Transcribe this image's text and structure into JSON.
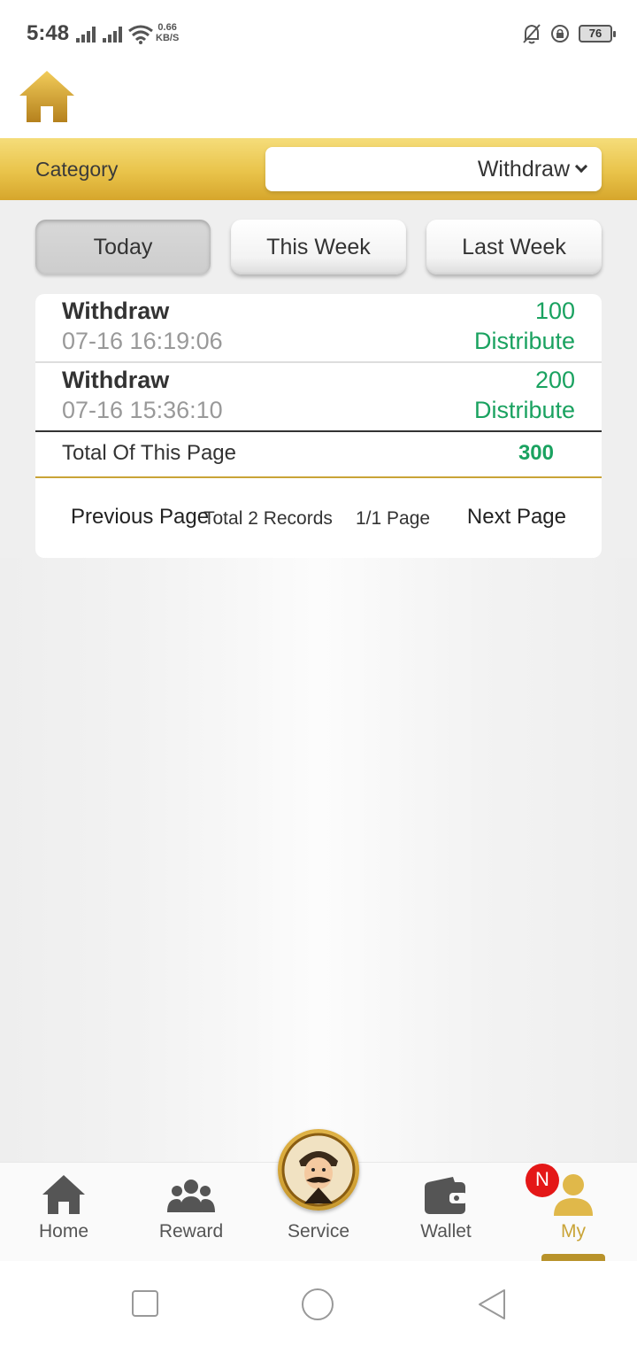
{
  "status_bar": {
    "time": "5:48",
    "net_speed_value": "0.66",
    "net_speed_unit": "KB/S",
    "battery": "76"
  },
  "category": {
    "label": "Category",
    "selected": "Withdraw"
  },
  "tabs": [
    {
      "label": "Today",
      "active": true
    },
    {
      "label": "This Week",
      "active": false
    },
    {
      "label": "Last Week",
      "active": false
    }
  ],
  "records": [
    {
      "title": "Withdraw",
      "time": "07-16 16:19:06",
      "amount": "100",
      "status": "Distribute"
    },
    {
      "title": "Withdraw",
      "time": "07-16 15:36:10",
      "amount": "200",
      "status": "Distribute"
    }
  ],
  "total": {
    "label": "Total Of This Page",
    "value": "300"
  },
  "pager": {
    "previous": "Previous Page",
    "records": "Total 2 Records",
    "pages": "1/1 Page",
    "next": "Next Page"
  },
  "nav": {
    "items": [
      {
        "label": "Home",
        "icon": "home-icon"
      },
      {
        "label": "Reward",
        "icon": "group-icon"
      },
      {
        "label": "Service",
        "icon": "service-avatar"
      },
      {
        "label": "Wallet",
        "icon": "wallet-icon"
      },
      {
        "label": "My",
        "icon": "user-icon"
      }
    ],
    "badge": "N"
  },
  "colors": {
    "accent_gold": "#c9a437",
    "positive_green": "#1aa260",
    "badge_red": "#e41717"
  }
}
